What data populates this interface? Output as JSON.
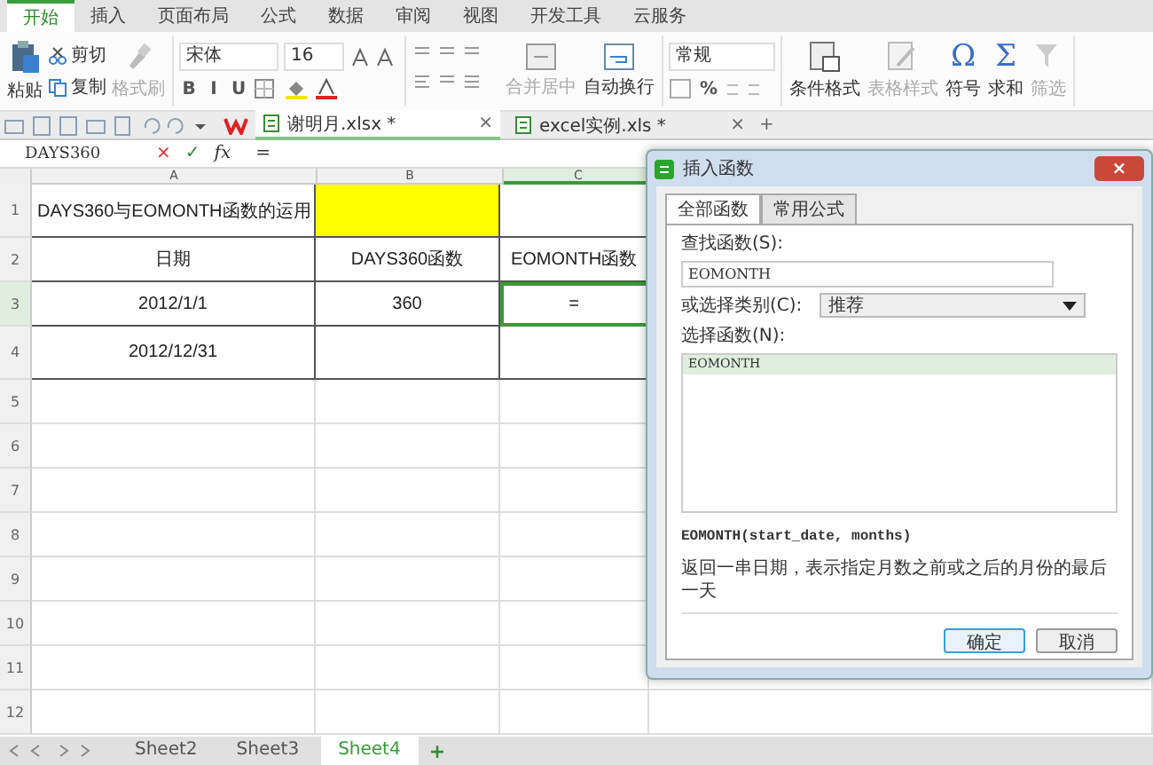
{
  "menu_tabs": [
    {
      "label": "开始",
      "selected": true
    },
    {
      "label": "插入",
      "selected": false
    },
    {
      "label": "页面布局",
      "selected": false
    },
    {
      "label": "公式",
      "selected": false
    },
    {
      "label": "数据",
      "selected": false
    },
    {
      "label": "审阅",
      "selected": false
    },
    {
      "label": "视图",
      "selected": false
    },
    {
      "label": "开发工具",
      "selected": false
    },
    {
      "label": "云服务",
      "selected": false
    }
  ],
  "ribbon": {
    "paste": "粘贴",
    "clipboard": [
      {
        "label": "剪切",
        "kind": "cut",
        "disabled": false
      },
      {
        "label": "复制",
        "kind": "copy",
        "disabled": false
      }
    ],
    "format_painter": {
      "label": "格式刷",
      "disabled": true
    },
    "font_name": "宋体",
    "font_size": "16",
    "format_buttons": [
      "B",
      "I",
      "U"
    ],
    "merge": {
      "label": "合并居中",
      "disabled": true
    },
    "wrap": {
      "label": "自动换行",
      "disabled": false
    },
    "number_format": "常规",
    "percent": "%",
    "big_buttons": [
      {
        "label": "条件格式",
        "kind": "conditional",
        "disabled": false
      },
      {
        "label": "表格样式",
        "kind": "table",
        "disabled": true
      },
      {
        "label": "符号",
        "kind": "glyph",
        "glyph": "Ω",
        "disabled": false
      },
      {
        "label": "求和",
        "kind": "glyph",
        "glyph": "Σ",
        "disabled": false
      },
      {
        "label": "筛选",
        "kind": "filter",
        "disabled": true
      }
    ]
  },
  "doc_tabs": [
    {
      "label": "谢明月.xlsx *",
      "selected": true,
      "close": "×"
    },
    {
      "label": "excel实例.xls *",
      "selected": false,
      "close": "×"
    }
  ],
  "new_tab": "+",
  "formula_bar": {
    "name_box": "DAYS360",
    "cancel": "×",
    "confirm": "✓",
    "fx": "fx",
    "formula": "="
  },
  "sheet": {
    "columns": [
      {
        "label": "A",
        "selected": false
      },
      {
        "label": "B",
        "selected": false
      },
      {
        "label": "C",
        "selected": true
      }
    ],
    "rows": [
      {
        "header": "1",
        "selected": false,
        "cells": [
          {
            "text": "DAYS360与EOMONTH函数的运用"
          },
          {
            "text": "",
            "color": "#ffff00"
          },
          {
            "text": ""
          }
        ]
      },
      {
        "header": "2",
        "selected": false,
        "cells": [
          {
            "text": "日期"
          },
          {
            "text": "DAYS360函数"
          },
          {
            "text": "EOMONTH函数"
          }
        ]
      },
      {
        "header": "3",
        "selected": true,
        "cells": [
          {
            "text": "2012/1/1"
          },
          {
            "text": "360"
          },
          {
            "text": "="
          }
        ]
      },
      {
        "header": "4",
        "selected": false,
        "cells": [
          {
            "text": "2012/12/31"
          },
          {
            "text": ""
          },
          {
            "text": ""
          }
        ]
      },
      {
        "header": "5",
        "selected": false,
        "cells": []
      },
      {
        "header": "6",
        "selected": false,
        "cells": []
      },
      {
        "header": "7",
        "selected": false,
        "cells": []
      },
      {
        "header": "8",
        "selected": false,
        "cells": []
      },
      {
        "header": "9",
        "selected": false,
        "cells": []
      },
      {
        "header": "10",
        "selected": false,
        "cells": []
      },
      {
        "header": "11",
        "selected": false,
        "cells": []
      },
      {
        "header": "12",
        "selected": false,
        "cells": []
      }
    ]
  },
  "sheet_tabs": [
    {
      "label": "Sheet2",
      "selected": false
    },
    {
      "label": "Sheet3",
      "selected": false
    },
    {
      "label": "Sheet4",
      "selected": true
    }
  ],
  "new_sheet": "+",
  "dialog": {
    "title": "插入函数",
    "close": "×",
    "tabs": [
      {
        "label": "全部函数",
        "selected": true
      },
      {
        "label": "常用公式",
        "selected": false
      }
    ],
    "search_label": "查找函数(S):",
    "search_value": "EOMONTH",
    "category_label": "或选择类别(C):",
    "category": "推荐",
    "function_label": "选择函数(N):",
    "functions": [
      {
        "name": "EOMONTH",
        "selected": true
      }
    ],
    "signature": "EOMONTH(start_date, months)",
    "description": "返回一串日期，表示指定月数之前或之后的月份的最后一天",
    "buttons": [
      {
        "label": "确定",
        "kind": "primary"
      },
      {
        "label": "取消",
        "kind": "normal"
      }
    ]
  }
}
